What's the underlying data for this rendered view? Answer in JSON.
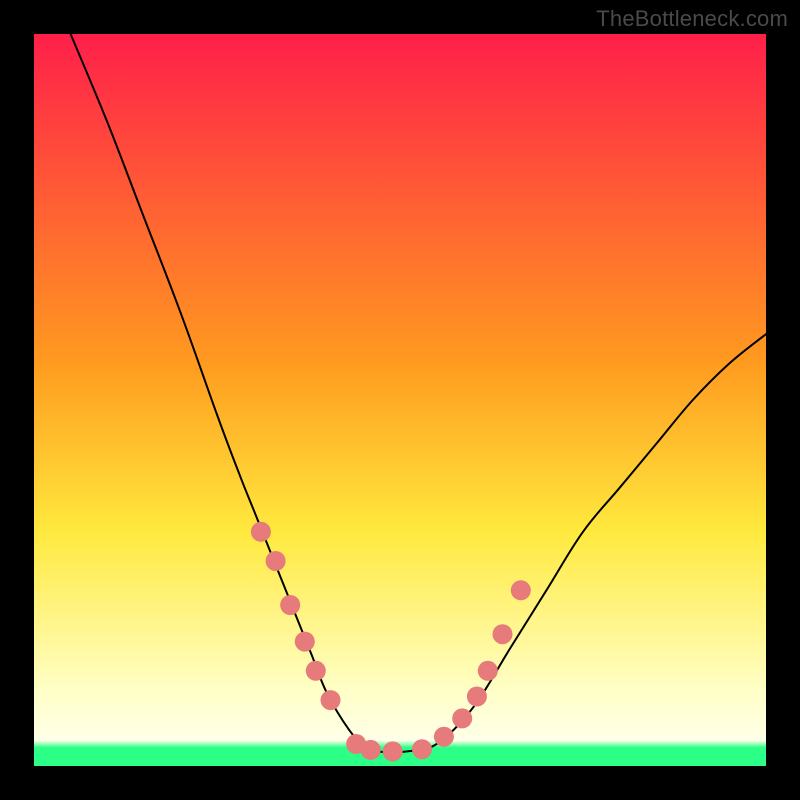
{
  "watermark": "TheBottleneck.com",
  "colors": {
    "black_frame": "#000000",
    "gradient_top": "#ff1f4a",
    "gradient_mid1": "#ff9b1f",
    "gradient_mid2": "#ffe93e",
    "gradient_bottom_pale": "#ffffc8",
    "gradient_green_bar": "#2cff86",
    "curve_stroke": "#000000",
    "dot_fill": "#e77a7a"
  },
  "chart_data": {
    "type": "line",
    "title": "",
    "xlabel": "",
    "ylabel": "",
    "xlim": [
      0,
      100
    ],
    "ylim": [
      0,
      100
    ],
    "grid": false,
    "legend": false,
    "annotations": [
      {
        "text": "TheBottleneck.com",
        "position": "top-right"
      }
    ],
    "series": [
      {
        "name": "bottleneck-curve",
        "kind": "line",
        "x": [
          5,
          10,
          15,
          20,
          25,
          28,
          30,
          32,
          34,
          36,
          38,
          40,
          43,
          45,
          47,
          49,
          51,
          55,
          60,
          65,
          70,
          75,
          80,
          85,
          90,
          95,
          100
        ],
        "y": [
          100,
          88,
          75,
          62,
          48,
          40,
          35,
          30,
          25,
          20,
          15,
          10,
          5,
          3,
          2,
          2,
          2,
          3,
          8,
          16,
          24,
          32,
          38,
          44,
          50,
          55,
          59
        ]
      },
      {
        "name": "curve-dots",
        "kind": "scatter",
        "x": [
          31,
          33,
          35,
          37,
          38.5,
          40.5,
          44,
          46,
          49,
          53,
          56,
          58.5,
          60.5,
          62,
          64,
          66.5
        ],
        "y": [
          32,
          28,
          22,
          17,
          13,
          9,
          3,
          2.2,
          2.0,
          2.3,
          4,
          6.5,
          9.5,
          13,
          18,
          24
        ]
      }
    ],
    "background_gradient": {
      "stops": [
        {
          "pos": 0.0,
          "color": "#ff1f4a"
        },
        {
          "pos": 0.45,
          "color": "#ff9b1f"
        },
        {
          "pos": 0.68,
          "color": "#ffe93e"
        },
        {
          "pos": 0.9,
          "color": "#ffffc8"
        },
        {
          "pos": 0.965,
          "color": "#ffffe8"
        },
        {
          "pos": 0.975,
          "color": "#2cff86"
        },
        {
          "pos": 1.0,
          "color": "#2cff86"
        }
      ]
    }
  }
}
